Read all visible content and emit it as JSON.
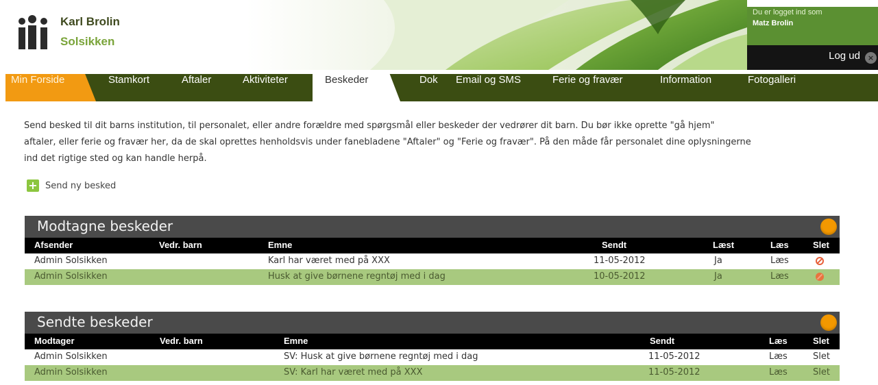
{
  "header": {
    "child_name": "Karl Brolin",
    "institution": "Solsikken",
    "logged_in_label": "Du er logget ind som",
    "user_name": "Matz Brolin",
    "logout_label": "Log ud"
  },
  "nav": {
    "items": [
      {
        "label": "Min Forside"
      },
      {
        "label": "Stamkort"
      },
      {
        "label": "Aftaler"
      },
      {
        "label": "Aktiviteter"
      },
      {
        "label": "Beskeder"
      },
      {
        "label": "Dok"
      },
      {
        "label": "Email og SMS"
      },
      {
        "label": "Ferie og fravær"
      },
      {
        "label": "Information"
      },
      {
        "label": "Fotogalleri"
      }
    ],
    "active": "Beskeder"
  },
  "intro": {
    "line1": "Send besked til dit barns institution, til personalet, eller andre forældre med spørgsmål eller beskeder der vedrører dit barn. Du bør ikke oprette \"gå hjem\"",
    "line2": "aftaler, eller ferie og fravær her, da de skal oprettes henholdsvis under fanebladene \"Aftaler\" og \"Ferie og fravær\". På den måde får personalet dine oplysningerne",
    "line3": "ind det rigtige sted og kan handle herpå."
  },
  "new_message_label": "Send ny besked",
  "received": {
    "title": "Modtagne beskeder",
    "columns": {
      "sender": "Afsender",
      "child": "Vedr. barn",
      "subject": "Emne",
      "sent": "Sendt",
      "read": "Læst",
      "read_action": "Læs",
      "delete": "Slet"
    },
    "rows": [
      {
        "sender": "Admin Solsikken",
        "child": "",
        "subject": "Karl har været med på XXX",
        "sent": "11-05-2012",
        "read": "Ja",
        "read_action": "Læs"
      },
      {
        "sender": "Admin Solsikken",
        "child": "",
        "subject": "Husk at give børnene regntøj med i dag",
        "sent": "10-05-2012",
        "read": "Ja",
        "read_action": "Læs"
      }
    ]
  },
  "sent": {
    "title": "Sendte beskeder",
    "columns": {
      "recipient": "Modtager",
      "child": "Vedr. barn",
      "subject": "Emne",
      "sent": "Sendt",
      "read_action": "Læs",
      "delete": "Slet"
    },
    "rows": [
      {
        "recipient": "Admin Solsikken",
        "child": "",
        "subject": "SV: Husk at give børnene regntøj med i dag",
        "sent": "11-05-2012",
        "read_action": "Læs",
        "delete": "Slet"
      },
      {
        "recipient": "Admin Solsikken",
        "child": "",
        "subject": "SV: Karl har været med på XXX",
        "sent": "11-05-2012",
        "read_action": "Læs",
        "delete": "Slet"
      }
    ]
  },
  "colors": {
    "nav_bg": "#3b4d12",
    "home_tab": "#f29a12",
    "panel_title_bg": "#4a4a4a",
    "alt_row": "#a8c97f",
    "accent_dot": "#f39800"
  }
}
